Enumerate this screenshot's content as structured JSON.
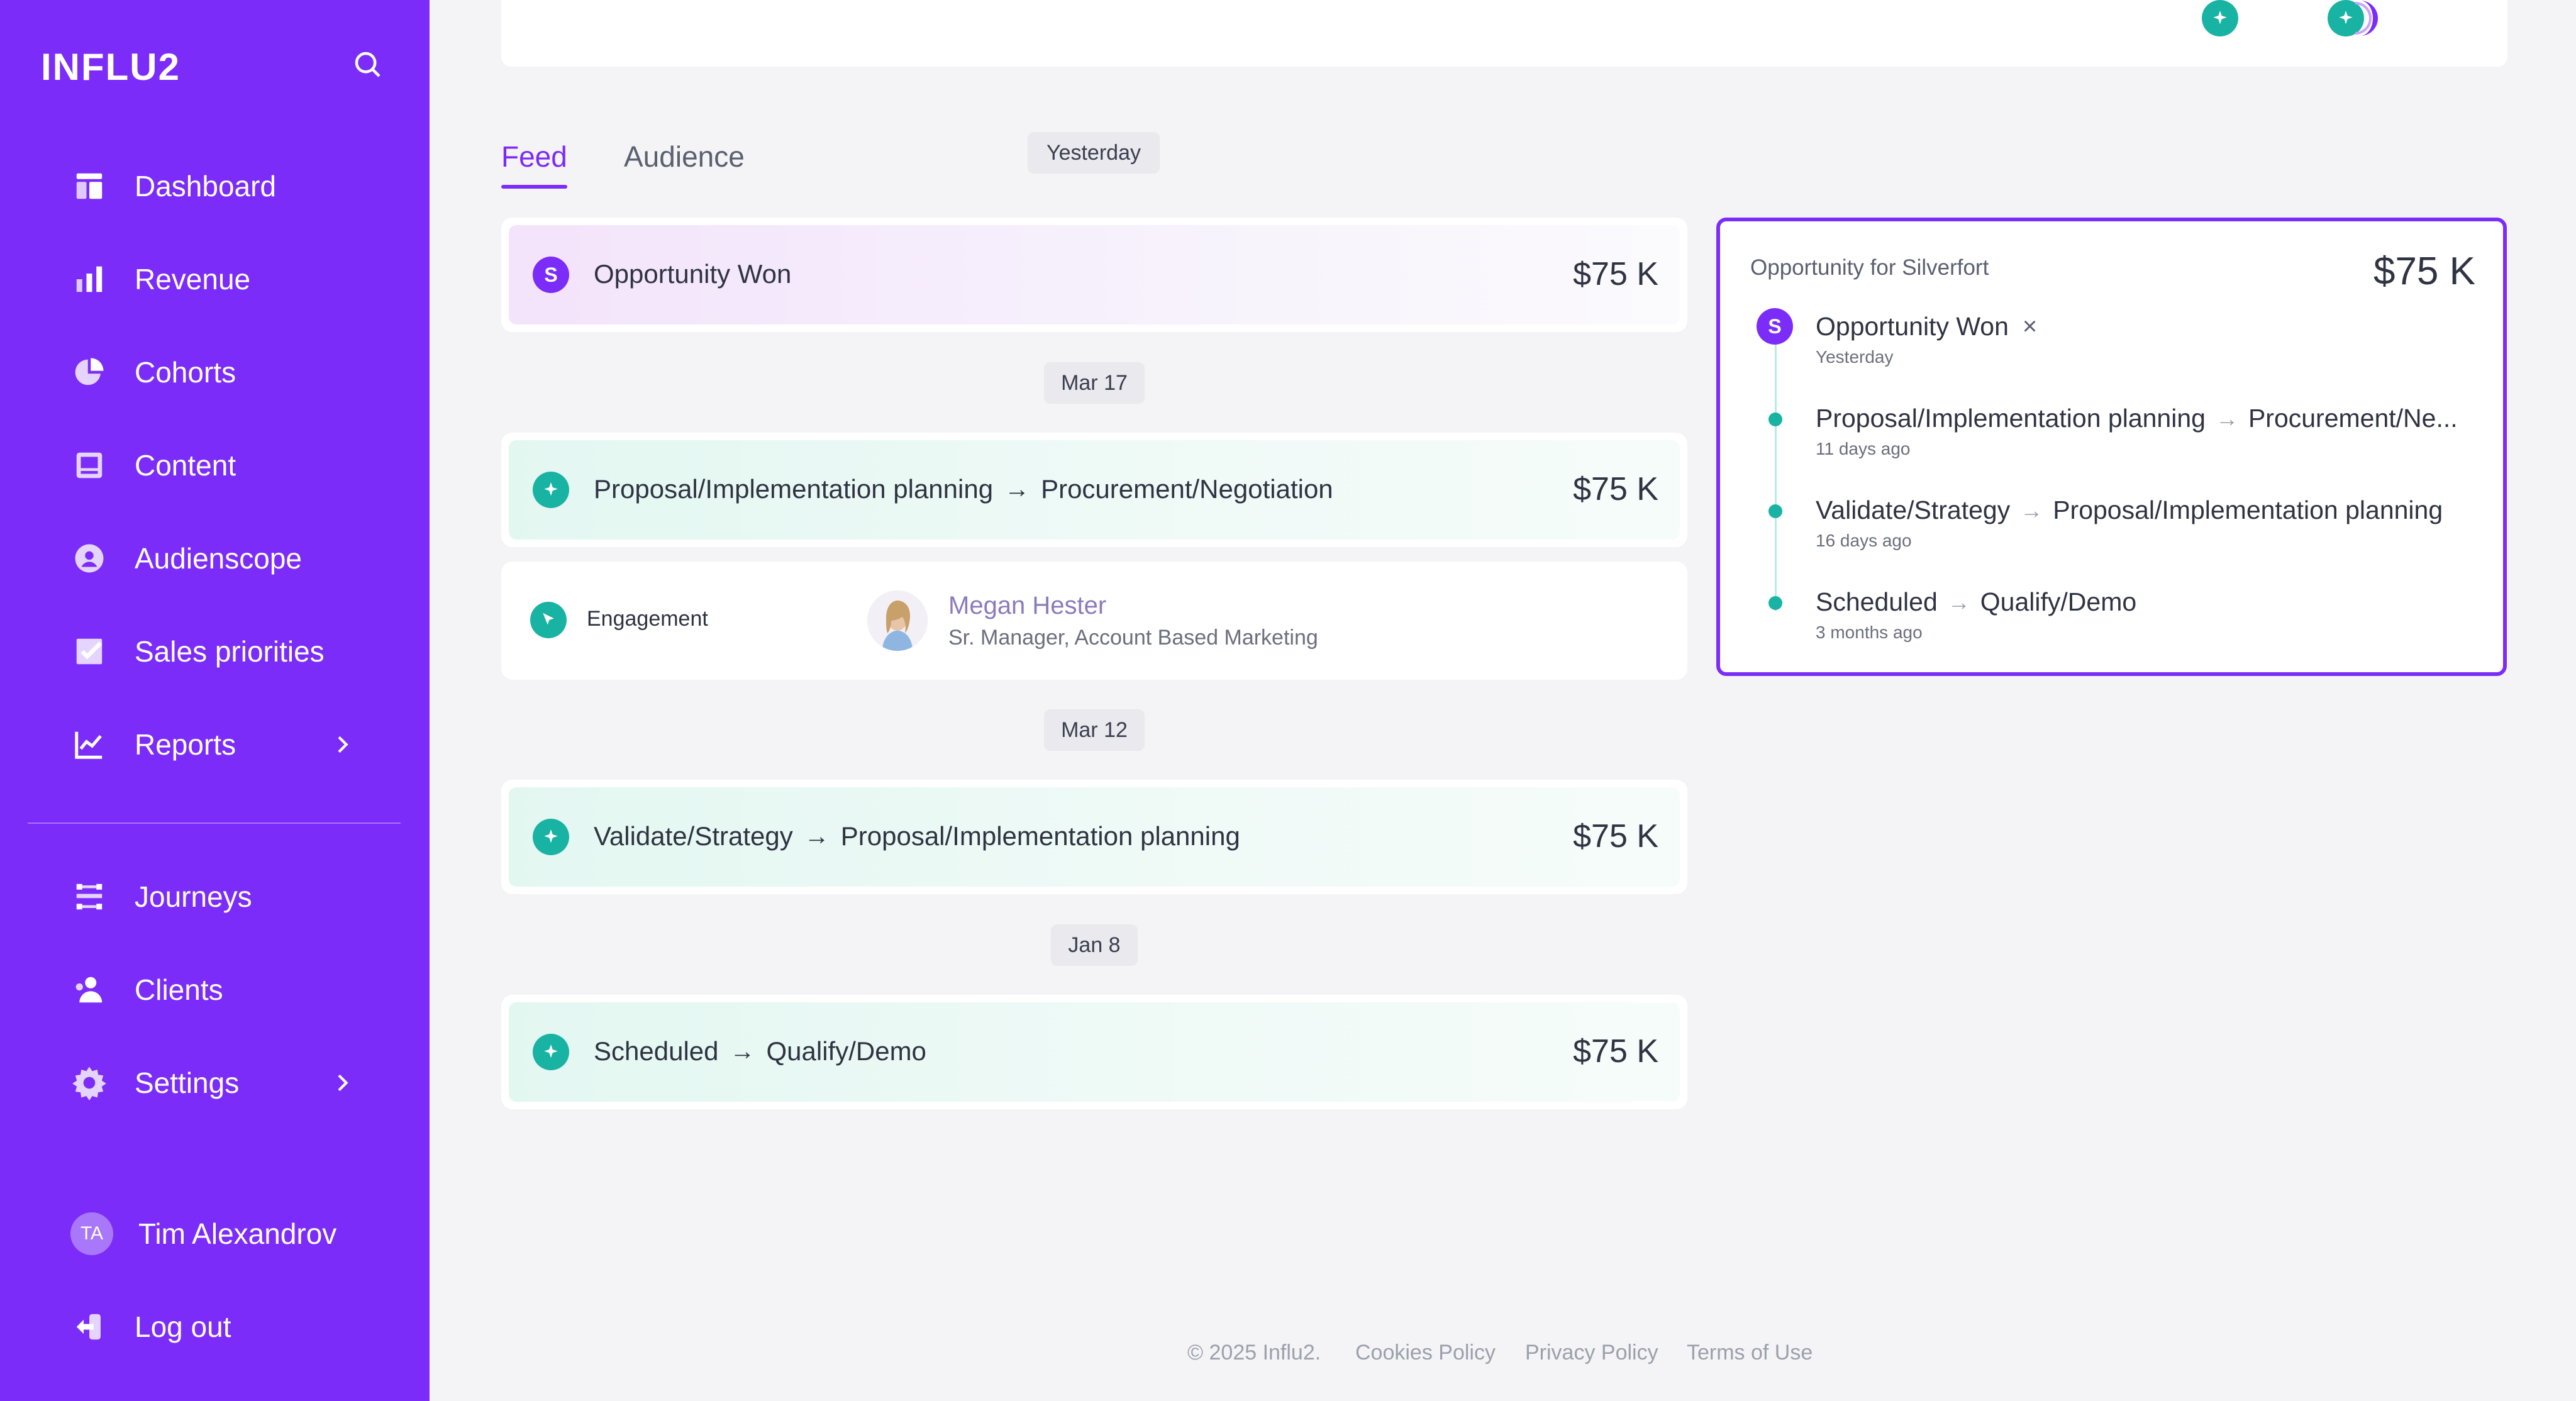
{
  "app": {
    "brand": "INFLU2"
  },
  "sidebar": {
    "items": [
      {
        "label": "Dashboard",
        "icon": "dashboard-icon"
      },
      {
        "label": "Revenue",
        "icon": "bar-chart-icon"
      },
      {
        "label": "Cohorts",
        "icon": "pie-chart-icon"
      },
      {
        "label": "Content",
        "icon": "content-icon"
      },
      {
        "label": "Audienscope",
        "icon": "audience-icon"
      },
      {
        "label": "Sales priorities",
        "icon": "checkbox-icon"
      },
      {
        "label": "Reports",
        "icon": "line-chart-icon"
      },
      {
        "label": "Journeys",
        "icon": "journeys-icon"
      },
      {
        "label": "Clients",
        "icon": "clients-icon"
      },
      {
        "label": "Settings",
        "icon": "gear-icon"
      }
    ],
    "user": {
      "initials": "TA",
      "name": "Tim Alexandrov"
    },
    "logout_label": "Log out"
  },
  "tabs": {
    "feed": "Feed",
    "audience": "Audience"
  },
  "feed": {
    "groups": [
      {
        "date": "Yesterday"
      },
      {
        "date": "Mar 17"
      },
      {
        "date": "Mar 12"
      },
      {
        "date": "Jan 8"
      }
    ],
    "cards": [
      {
        "title": "Opportunity Won",
        "icon_letter": "S",
        "amount": "$75 K"
      },
      {
        "from": "Proposal/Implementation planning",
        "to": "Procurement/Negotiation",
        "amount": "$75 K"
      },
      {
        "from": "Validate/Strategy",
        "to": "Proposal/Implementation planning",
        "amount": "$75 K"
      },
      {
        "from": "Scheduled",
        "to": "Qualify/Demo",
        "amount": "$75 K"
      }
    ],
    "engagement": {
      "label": "Engagement",
      "person_name": "Megan Hester",
      "person_title": "Sr. Manager, Account Based Marketing"
    }
  },
  "detail": {
    "heading": "Opportunity for Silverfort",
    "amount": "$75 K",
    "won": {
      "title": "Opportunity Won",
      "icon_letter": "S",
      "close": "×",
      "time": "Yesterday"
    },
    "timeline": [
      {
        "from": "Proposal/Implementation planning",
        "to": "Procurement/Ne...",
        "time": "11 days ago"
      },
      {
        "from": "Validate/Strategy",
        "to": "Proposal/Implementation planning",
        "time": "16 days ago"
      },
      {
        "from": "Scheduled",
        "to": "Qualify/Demo",
        "time": "3 months ago"
      }
    ]
  },
  "footer": {
    "copyright": "© 2025 Influ2.",
    "links": [
      "Cookies Policy",
      "Privacy Policy",
      "Terms of Use"
    ]
  },
  "colors": {
    "sidebar": "#7c2cf8",
    "accent": "#7c2cf8",
    "teal": "#19b3a3"
  }
}
